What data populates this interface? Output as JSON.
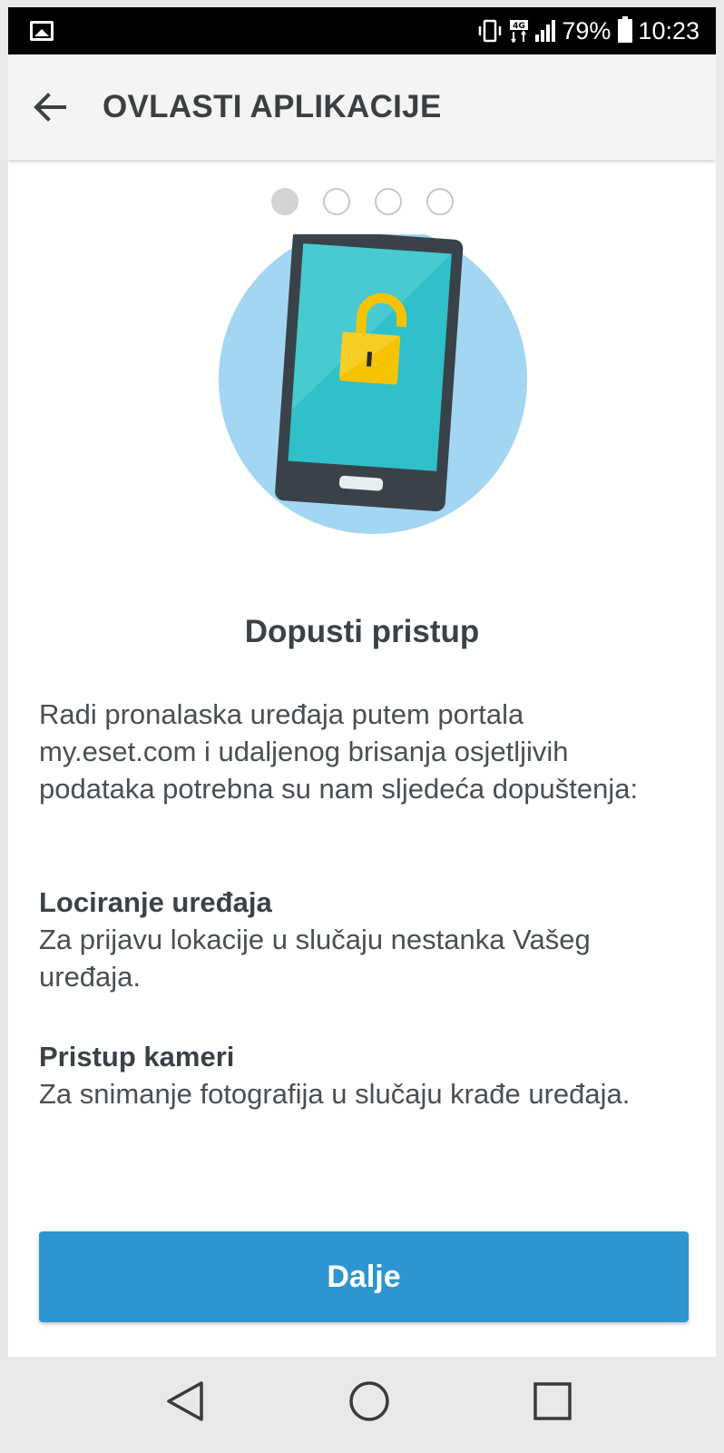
{
  "status_bar": {
    "left_icon": "gallery-icon",
    "icons": [
      "vibrate-icon",
      "network-4g-icon",
      "signal-icon"
    ],
    "battery_percent": "79%",
    "battery_icon": "battery-icon",
    "time": "10:23"
  },
  "app_bar": {
    "back_icon": "back-arrow-icon",
    "title": "OVLASTI APLIKACIJE"
  },
  "pager": {
    "total": 4,
    "active_index": 0
  },
  "illustration": {
    "icon": "phone-unlocked-padlock-icon",
    "colors": {
      "circle": "#a3d6f2",
      "phone_body": "#3a4249",
      "screen": "#2fc0c9",
      "padlock": "#f5c300"
    }
  },
  "content": {
    "heading": "Dopusti pristup",
    "intro": "Radi pronalaska uređaja putem portala my.eset.com i udaljenog brisanja osjetljivih podataka potrebna su nam sljedeća dopuštenja:",
    "permissions": [
      {
        "title": "Lociranje uređaja",
        "description": "Za prijavu lokacije u slučaju nestanka Vašeg uređaja."
      },
      {
        "title": "Pristup kameri",
        "description": "Za snimanje fotografija u slučaju krađe uređaja."
      }
    ]
  },
  "button": {
    "label": "Dalje",
    "color": "#2d96d0"
  },
  "nav_bar": {
    "buttons": [
      "nav-back-icon",
      "nav-home-icon",
      "nav-recents-icon"
    ]
  }
}
